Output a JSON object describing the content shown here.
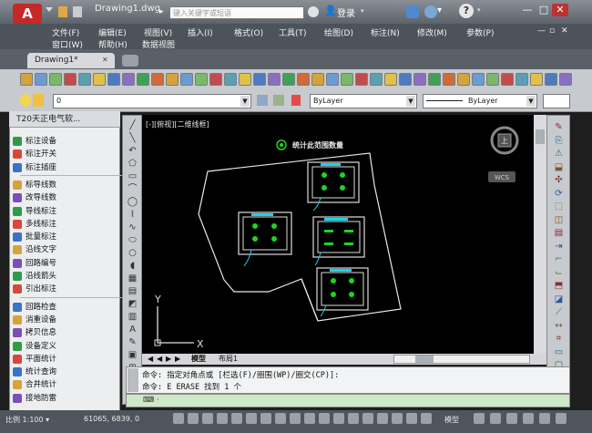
{
  "title_bar": {
    "app_letter": "A",
    "document_title": "Drawing1.dwg",
    "search_placeholder": "键入关键字或短语",
    "login_label": "登录",
    "help_glyph": "?",
    "window_controls": [
      "—",
      "□",
      "✕"
    ]
  },
  "menu": {
    "row1": [
      "文件(F)",
      "编辑(E)",
      "视图(V)",
      "插入(I)",
      "格式(O)",
      "工具(T)",
      "绘图(D)",
      "标注(N)",
      "修改(M)",
      "参数(P)"
    ],
    "row2": [
      "窗口(W)",
      "帮助(H)",
      "数据视图"
    ],
    "doc_controls": [
      "—",
      "▫",
      "✕"
    ]
  },
  "tabs": {
    "active": "Drawing1*",
    "close_glyph": "✕"
  },
  "toolbar2": {
    "layer_value": "0",
    "color_value": "ByLayer",
    "linetype_value": "ByLayer"
  },
  "palette": {
    "title": "T20天正电气软...",
    "groups": [
      [
        "标注设备",
        "标注开关",
        "标注插座"
      ],
      [
        "标导线数",
        "改导线数",
        "导线标注",
        "多线标注",
        "批量标注",
        "沿线文字",
        "回路编号",
        "沿线箭头",
        "引出标注"
      ],
      [
        "回路检查",
        "消重设备",
        "拷贝信息",
        "设备定义",
        "平面统计",
        "统计查询",
        "合并统计",
        "接地防雷"
      ]
    ]
  },
  "canvas": {
    "view_label": "[-][俯视][二维线框]",
    "annotation": "统计此范围数量",
    "compass_label": "WCS",
    "compass_letter": "上",
    "ucs_y": "Y",
    "ucs_x": "X"
  },
  "layout_tabs": {
    "model": "模型",
    "layout1": "布局1",
    "nav_glyphs": [
      "◀",
      "◀",
      "▶",
      "▶"
    ]
  },
  "command": {
    "line1": "命令: 指定对角点或 [栏选(F)/圈围(WP)/圈交(CP)]:",
    "line2": "命令: E ERASE 找到 1 个",
    "input_prefix": "⌨ ·"
  },
  "status_bar": {
    "scale": "比例 1:100 ▾",
    "coords": "61065, 6839, 0",
    "model_label": "模型"
  },
  "colors": {
    "title_bg": "#6d737a",
    "canvas_bg": "#000000",
    "boundary": "#e8e8e8",
    "equipment_green": "#1fd41f",
    "cyan": "#19d3e6",
    "cmd_input_bg": "#cfe8c8"
  }
}
